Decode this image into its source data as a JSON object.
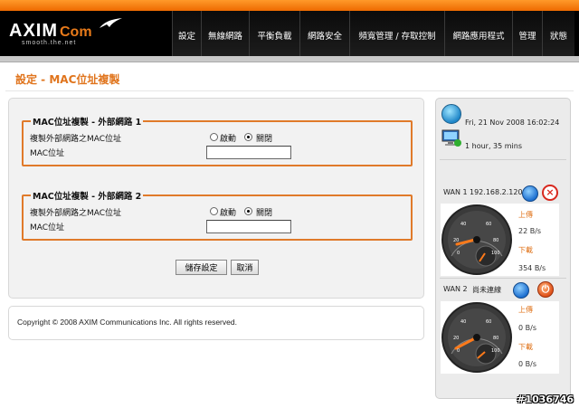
{
  "brand": {
    "name": "AXIM",
    "name_suffix": "Com",
    "tagline": "smooth.the.net"
  },
  "nav": {
    "items": [
      {
        "label": "設定"
      },
      {
        "label": "無線網路"
      },
      {
        "label": "平衡負載"
      },
      {
        "label": "網路安全"
      },
      {
        "label": "頻寬管理 / 存取控制"
      },
      {
        "label": "網路應用程式"
      },
      {
        "label": "管理"
      },
      {
        "label": "狀態"
      }
    ]
  },
  "page": {
    "title": "設定 - MAC位址複製"
  },
  "wan_sections": [
    {
      "legend": "MAC位址複製 - 外部網路 1",
      "clone_label": "複製外部網路之MAC位址",
      "enable_label": "啟動",
      "disable_label": "關閉",
      "selected": "關閉",
      "mac_label": "MAC位址",
      "mac_value": ""
    },
    {
      "legend": "MAC位址複製 - 外部網路 2",
      "clone_label": "複製外部網路之MAC位址",
      "enable_label": "啟動",
      "disable_label": "關閉",
      "selected": "關閉",
      "mac_label": "MAC位址",
      "mac_value": ""
    }
  ],
  "buttons": {
    "save": "儲存設定",
    "cancel": "取消"
  },
  "footer": {
    "copyright": "Copyright © 2008 AXIM Communications Inc. All rights reserved."
  },
  "status": {
    "datetime": "Fri, 21 Nov 2008 16:02:24",
    "uptime": "1 hour, 35 mins",
    "wans": [
      {
        "name": "WAN 1",
        "address": "192.168.2.120",
        "upload_label": "上傳",
        "upload_value": "22 B/s",
        "download_label": "下載",
        "download_value": "354 B/s",
        "gauge_ticks": [
          "0",
          "20",
          "40",
          "60",
          "80",
          "100"
        ]
      },
      {
        "name": "WAN 2",
        "address": "尚未連線",
        "upload_label": "上傳",
        "upload_value": "0 B/s",
        "download_label": "下載",
        "download_value": "0 B/s",
        "gauge_ticks": [
          "0",
          "20",
          "40",
          "60",
          "80",
          "100"
        ]
      }
    ]
  },
  "watermark": "#1036746",
  "colors": {
    "accent": "#e0741c",
    "nav_bg": "#000000",
    "panel_bg": "#f2f2f2"
  },
  "icons": [
    "globe-icon",
    "computer-icon",
    "connect-icon",
    "disconnect-icon",
    "power-icon"
  ]
}
